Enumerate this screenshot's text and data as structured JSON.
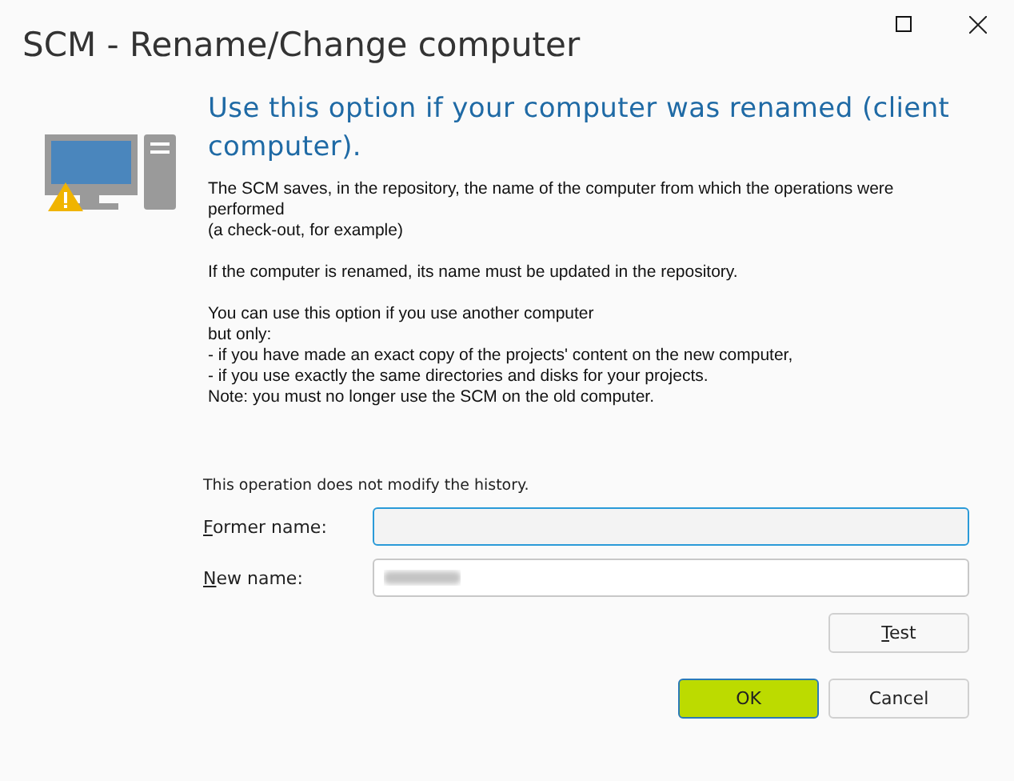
{
  "window": {
    "title": "SCM - Rename/Change computer"
  },
  "heading": "Use this option if your computer was renamed (client computer).",
  "paragraphs": [
    [
      "The SCM saves, in the repository, the name of the computer from which the operations were performed",
      "(a check-out, for example)"
    ],
    [
      "If the computer is renamed, its name must be updated in the repository."
    ],
    [
      "You can use this option if you use another computer",
      "but only:",
      "- if you have made an exact copy of the projects' content on the new computer,",
      "- if you use exactly the same directories and disks for your projects.",
      "Note: you must no longer use the SCM on the old computer."
    ]
  ],
  "note": "This operation does not modify the history.",
  "fields": [
    {
      "label": "Former name:",
      "focused": true,
      "blurred": false
    },
    {
      "label": "New name:",
      "focused": false,
      "blurred": true
    }
  ],
  "test_button": "Test",
  "buttons": [
    {
      "label": "OK",
      "default": true
    },
    {
      "label": "Cancel",
      "default": false
    }
  ]
}
